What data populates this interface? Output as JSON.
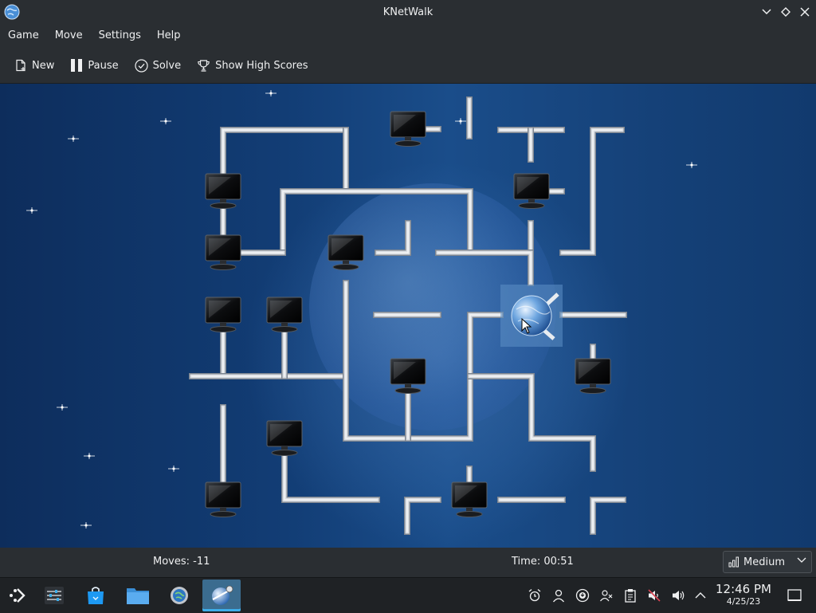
{
  "window": {
    "title": "KNetWalk"
  },
  "menu": [
    "Game",
    "Move",
    "Settings",
    "Help"
  ],
  "toolbar": {
    "new_label": "New",
    "pause_label": "Pause",
    "solve_label": "Solve",
    "high_scores_label": "Show High Scores"
  },
  "status": {
    "moves": "Moves: -11",
    "time": "Time: 00:51",
    "difficulty": "Medium"
  },
  "taskbar": {
    "time": "12:46 PM",
    "date": "4/25/23"
  },
  "colors": {
    "accent": "#3daee9",
    "board": "#123d75",
    "pipe": "#d9dde2"
  }
}
